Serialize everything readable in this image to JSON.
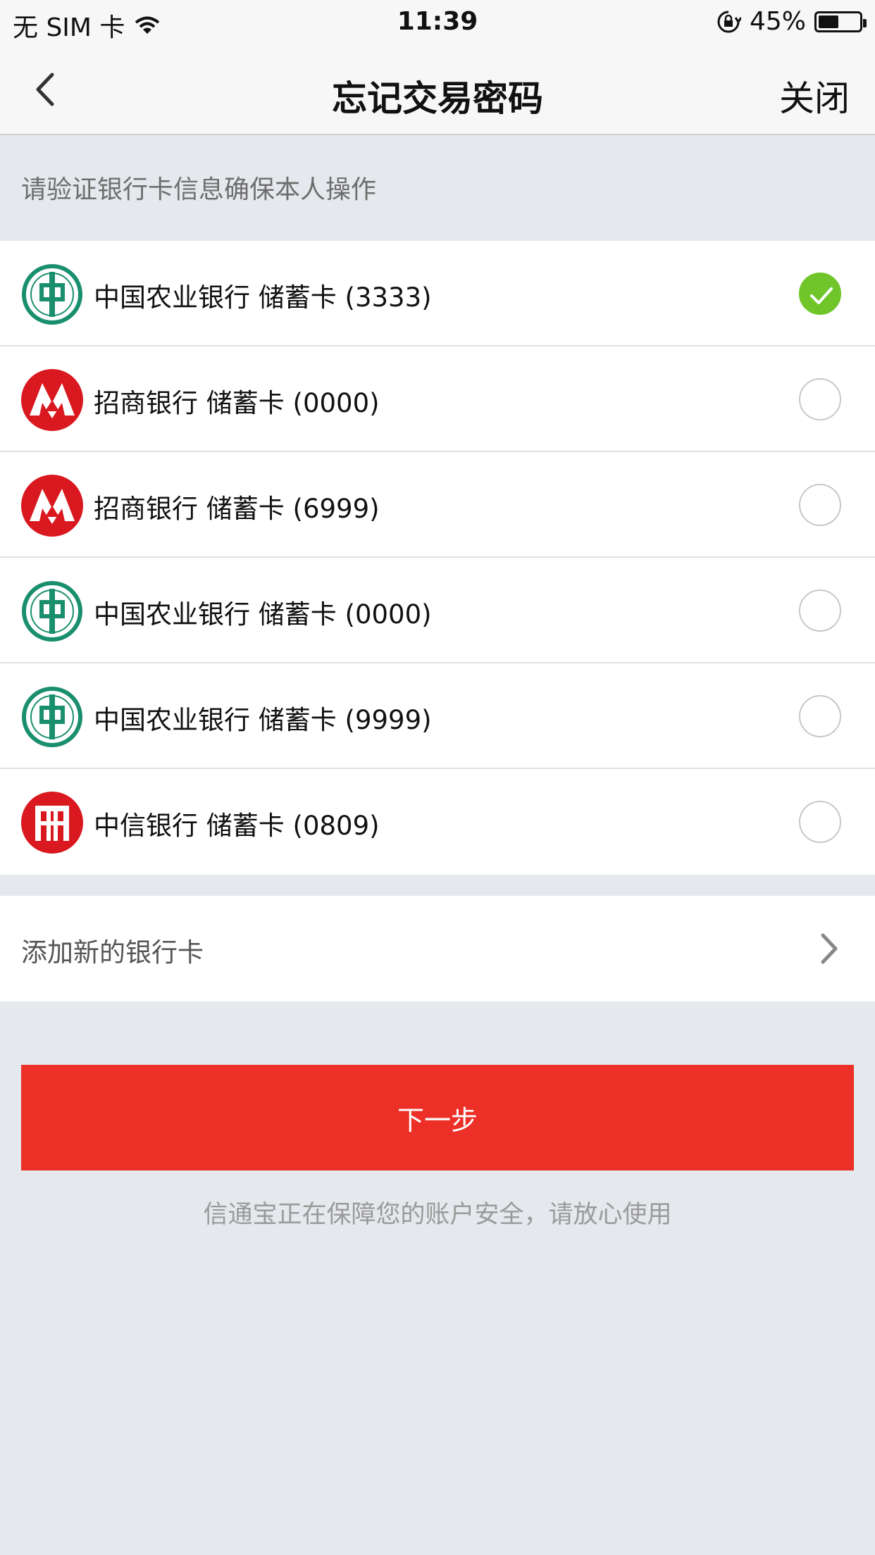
{
  "status_bar": {
    "carrier": "无 SIM 卡",
    "time": "11:39",
    "battery": "45%",
    "battery_level": 0.45
  },
  "nav": {
    "title": "忘记交易密码",
    "close_label": "关闭"
  },
  "hint": "请验证银行卡信息确保本人操作",
  "cards": [
    {
      "label": "中国农业银行  储蓄卡 (3333)",
      "bank": "abc",
      "selected": true
    },
    {
      "label": "招商银行  储蓄卡 (0000)",
      "bank": "cmb",
      "selected": false
    },
    {
      "label": "招商银行  储蓄卡 (6999)",
      "bank": "cmb",
      "selected": false
    },
    {
      "label": "中国农业银行  储蓄卡 (0000)",
      "bank": "abc",
      "selected": false
    },
    {
      "label": "中国农业银行  储蓄卡 (9999)",
      "bank": "abc",
      "selected": false
    },
    {
      "label": "中信银行  储蓄卡 (0809)",
      "bank": "citic",
      "selected": false
    }
  ],
  "add_card_label": "添加新的银行卡",
  "next_button_label": "下一步",
  "security_note": "信通宝正在保障您的账户安全，请放心使用",
  "colors": {
    "accent_red": "#ec3028",
    "check_green": "#6fc52a",
    "abc_green": "#1a8f6e",
    "bank_red": "#d9181f"
  }
}
